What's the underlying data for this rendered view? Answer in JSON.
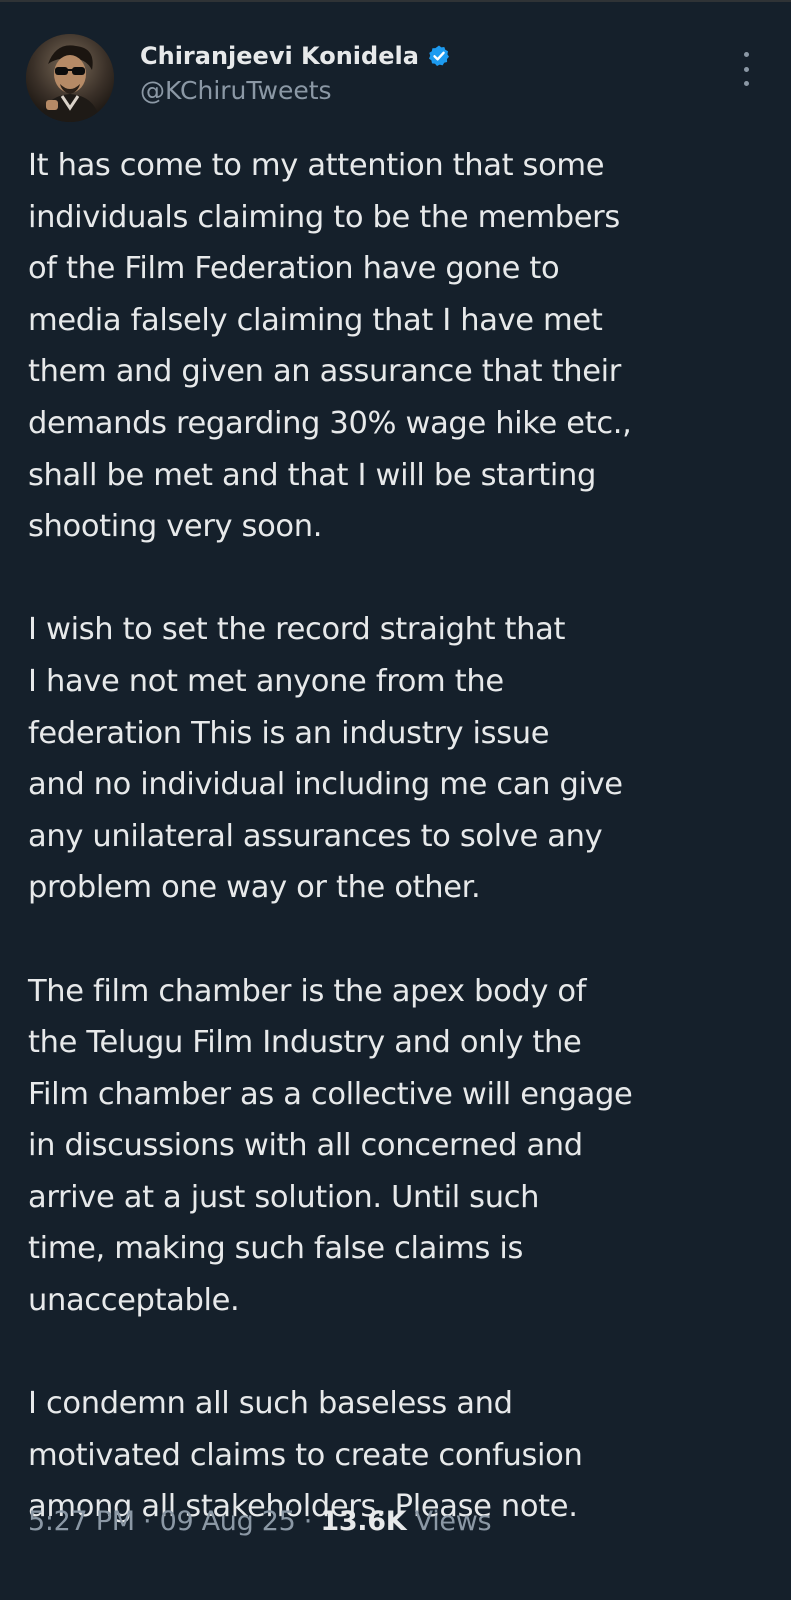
{
  "tweet": {
    "author": {
      "display_name": "Chiranjeevi Konidela",
      "handle": "@KChiruTweets",
      "verified": true,
      "verified_color": "#1d9bf0"
    },
    "paragraphs": [
      "It has come to my attention that some\nindividuals claiming to be the members\nof the Film Federation have gone to\nmedia falsely claiming that I have met\nthem and given an assurance that their\ndemands regarding  30% wage hike etc.,\nshall be met and that I will be starting\nshooting very soon.",
      "I wish to set the record straight that\nI have not met anyone from the\nfederation This is an industry issue\nand no individual including me can give\nany unilateral assurances to solve any\nproblem one way or the other.",
      "The film chamber is the apex body of\nthe Telugu Film Industry and only the\nFilm chamber as a collective will engage\nin discussions with all concerned and\narrive at a just solution. Until such\ntime, making such false claims is\nunacceptable.",
      "I condemn all such baseless and\nmotivated claims to create confusion\namong all stakeholders. Please note."
    ],
    "meta": {
      "time": "5:27 PM",
      "separator": " · ",
      "date": "09 Aug 25",
      "views_count": "13.6K",
      "views_label": " Views"
    }
  },
  "icons": {
    "verified": "verified-badge-icon",
    "more": "more-options-icon"
  },
  "colors": {
    "background": "#15202b",
    "text_primary": "#e7e9ea",
    "text_secondary": "#8b98a5",
    "accent": "#1d9bf0"
  }
}
